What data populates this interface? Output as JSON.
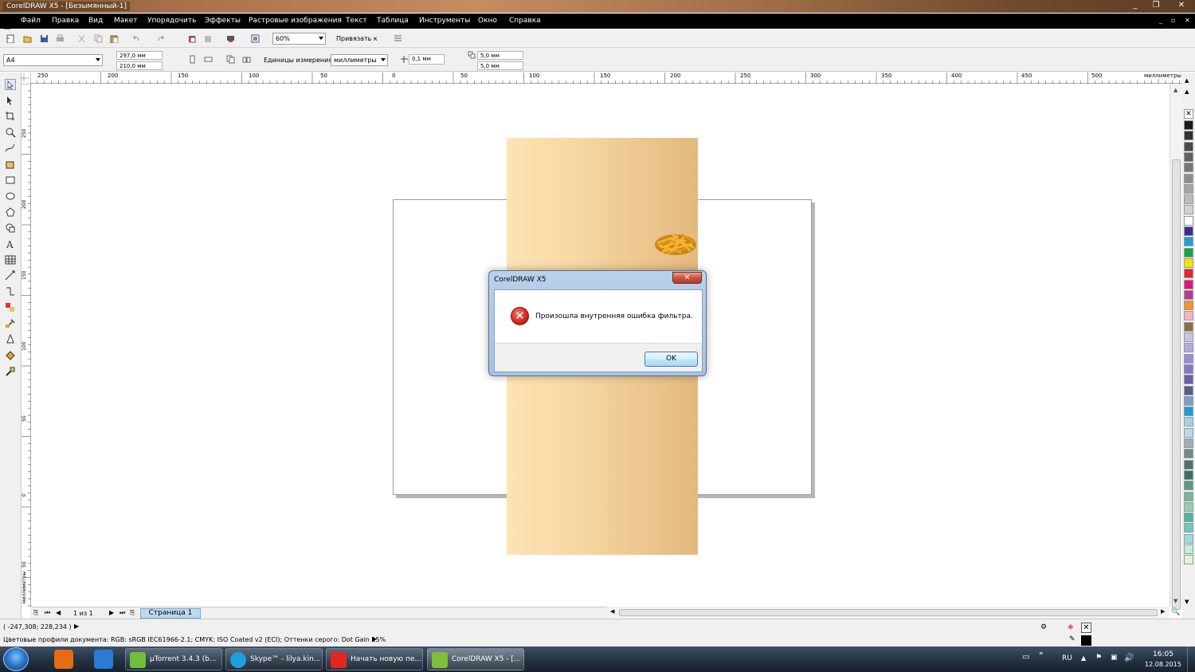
{
  "window": {
    "title": "CorelDRAW X5 - [Безымянный-1]",
    "min": "_",
    "max": "❐",
    "close": "✕"
  },
  "menu": [
    "Файл",
    "Правка",
    "Вид",
    "Макет",
    "Упорядочить",
    "Эффекты",
    "Растровые изображения",
    "Текст",
    "Таблица",
    "Инструменты",
    "Окно",
    "Справка"
  ],
  "toolbar": {
    "zoom": "60%",
    "snap_label": "Привязать к"
  },
  "property_bar": {
    "page_size": "A4",
    "width": "297,0 мм",
    "height": "210,0 мм",
    "units_label": "Единицы измерения:",
    "units_value": "миллиметры",
    "nudge": "0,1 мм",
    "dup_x": "5,0 мм",
    "dup_y": "5,0 мм"
  },
  "ruler": {
    "h_labels": [
      "250",
      "200",
      "150",
      "100",
      "50",
      "0",
      "50",
      "100",
      "150",
      "200",
      "250",
      "300",
      "350",
      "400",
      "450",
      "500"
    ],
    "h_unit": "миллиметры",
    "v_labels": [
      "250",
      "200",
      "150",
      "100",
      "50",
      "0",
      "50"
    ],
    "v_unit": "миллиметры"
  },
  "dialog": {
    "title": "CorelDRAW X5",
    "message": "Произошла внутренняя ошибка фильтра.",
    "ok": "OK"
  },
  "page_nav": {
    "counter": "1 из 1",
    "tab": "Страница 1"
  },
  "status": {
    "coords": "( -247,308; 228,234 )",
    "color_profiles": "Цветовые профили документа: RGB: sRGB IEC61966-2.1; CMYK: ISO Coated v2 (ECI); Оттенки серого: Dot Gain 15%"
  },
  "taskbar": {
    "items": [
      "µTorrent 3.4.3  (b...",
      "Skype™ - lilya.kin...",
      "Начать новую пе...",
      "CorelDRAW X5 - [..."
    ],
    "lang": "RU",
    "time": "16:05",
    "date": "12.08.2015"
  },
  "palette_colors": [
    "#1c1c1c",
    "#333333",
    "#4a4a4a",
    "#606060",
    "#777777",
    "#8e8e8e",
    "#a5a5a5",
    "#bcbcbc",
    "#d3d3d3",
    "#ffffff",
    "#3a2e8f",
    "#1f9fd9",
    "#14a54a",
    "#f2e500",
    "#e8262a",
    "#e0167f",
    "#b53b91",
    "#f7941d",
    "#f4b7c0",
    "#8a6e4b",
    "#c9c4e8",
    "#b5a9e0",
    "#9b8ed6",
    "#8776c9",
    "#6d5ca8",
    "#5a5e8a",
    "#7b9fc9",
    "#1a9fd9",
    "#9fd1ea",
    "#b9d9e8",
    "#9ab0b8",
    "#6e8a90",
    "#4e7070",
    "#3d6e6a",
    "#5a9a86",
    "#74b89c",
    "#8fcfb4",
    "#4ab5a0",
    "#6cc9c0",
    "#9adfd4",
    "#c4eedd",
    "#e0f5d6"
  ]
}
